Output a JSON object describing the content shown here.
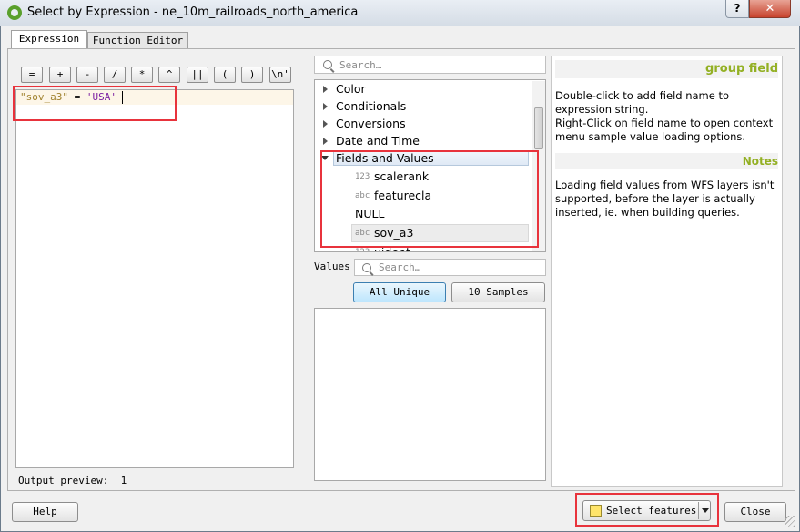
{
  "window": {
    "title": "Select by Expression - ne_10m_railroads_north_america"
  },
  "tabs": [
    {
      "label": "Expression",
      "active": true
    },
    {
      "label": "Function Editor",
      "active": false
    }
  ],
  "operators": [
    "=",
    "+",
    "-",
    "/",
    "*",
    "^",
    "||",
    "(",
    ")",
    "\\n'"
  ],
  "expression": {
    "field": "\"sov_a3\"",
    "operator": " = ",
    "value": "'USA'"
  },
  "output_preview": {
    "label": "Output preview:",
    "value": "1"
  },
  "function_search": {
    "placeholder": "Search…"
  },
  "function_tree": [
    {
      "label": "Color",
      "expanded": false
    },
    {
      "label": "Conditionals",
      "expanded": false
    },
    {
      "label": "Conversions",
      "expanded": false
    },
    {
      "label": "Date and Time",
      "expanded": false
    },
    {
      "label": "Fields and Values",
      "expanded": true,
      "selected": true
    }
  ],
  "fields": [
    {
      "type": "123",
      "label": "scalerank"
    },
    {
      "type": "abc",
      "label": "featurecla"
    },
    {
      "type": "",
      "label": "NULL"
    },
    {
      "type": "abc",
      "label": "sov_a3",
      "selected": true
    },
    {
      "type": "123",
      "label": "uident"
    }
  ],
  "values": {
    "label": "Values",
    "search_placeholder": "Search…",
    "all_unique_label": "All Unique",
    "samples_label": "10 Samples"
  },
  "help": {
    "heading": "group field",
    "body_1": "Double-click to add field name to expression string.",
    "body_2": "Right-Click on field name to open context menu sample value loading options.",
    "notes_heading": "Notes",
    "notes_body": "Loading field values from WFS layers isn't supported, before the layer is actually inserted, ie. when building queries."
  },
  "buttons": {
    "help": "Help",
    "select_features": "Select features",
    "close": "Close"
  },
  "colors": {
    "highlight_box": "#e8333c",
    "help_heading": "#93b023",
    "expression_field": "#a0822d",
    "expression_string": "#7b1fa2"
  }
}
